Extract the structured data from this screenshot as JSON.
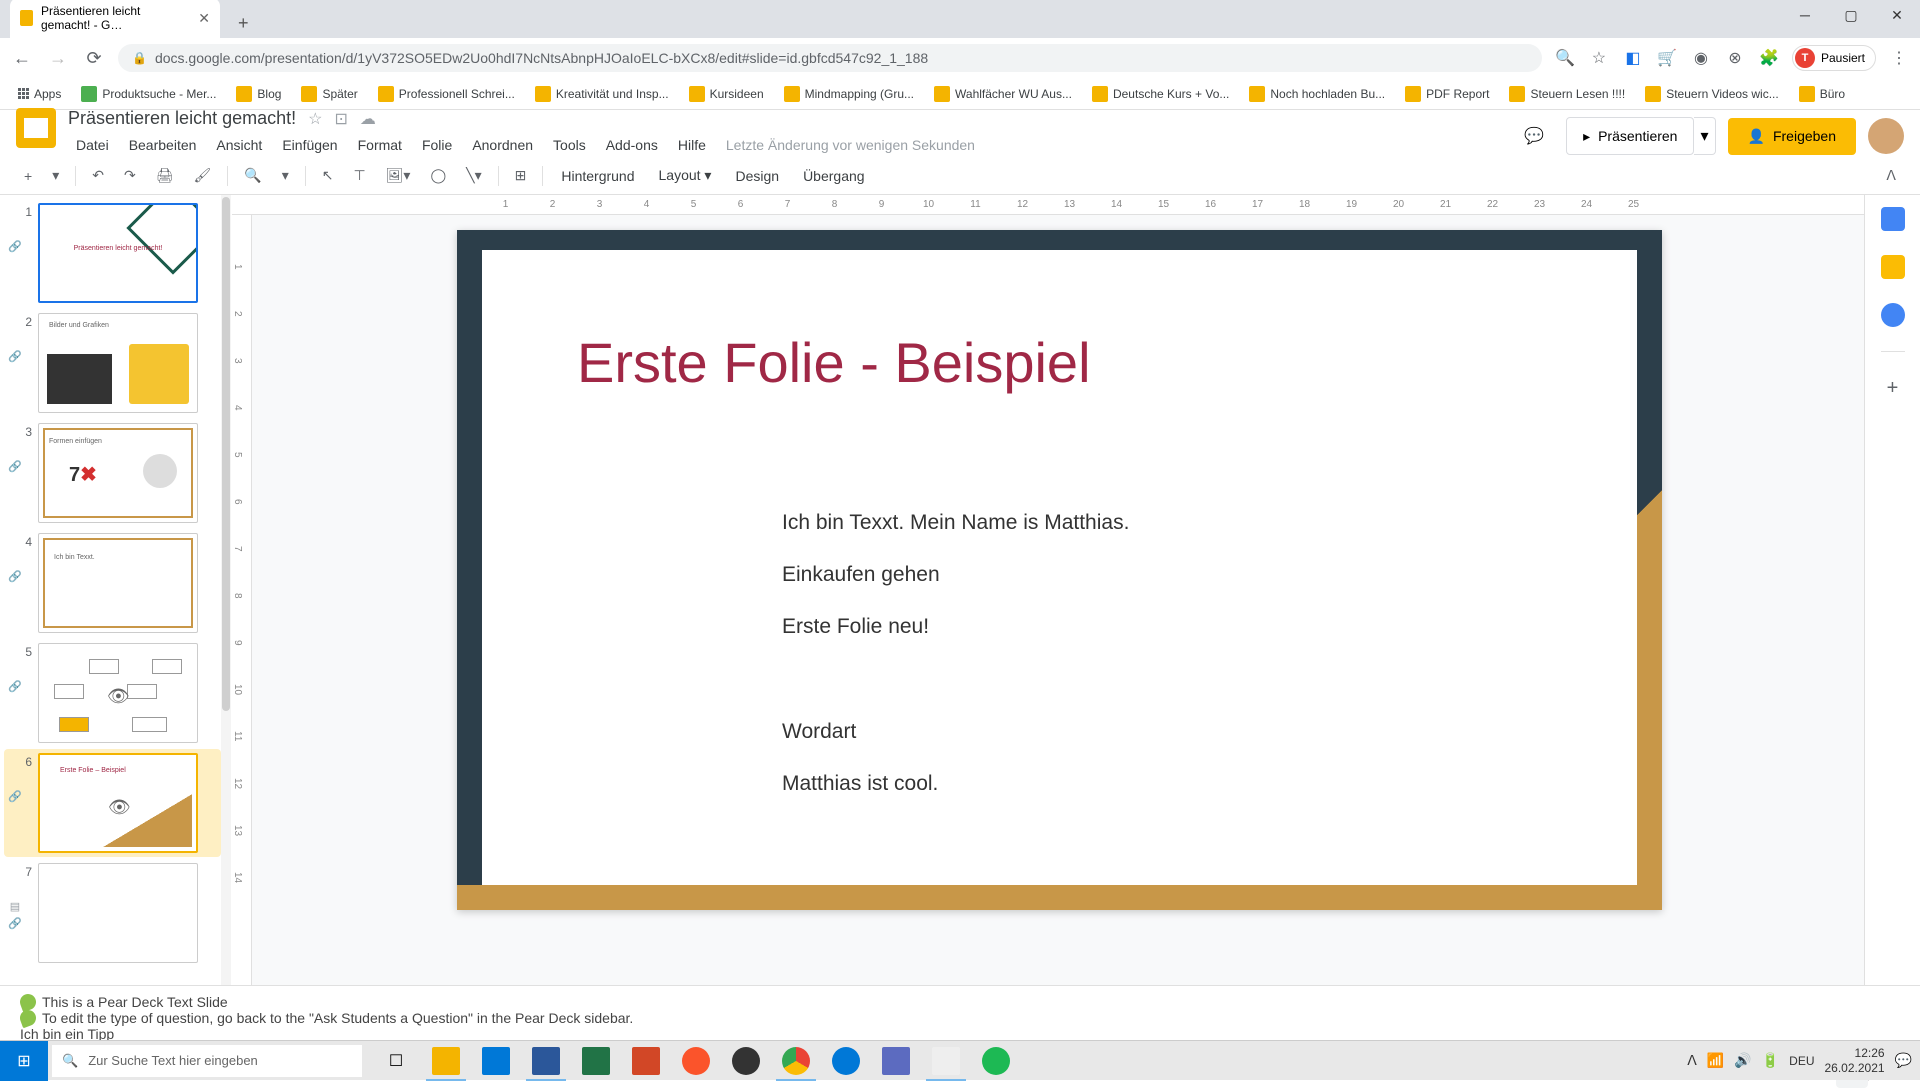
{
  "browser": {
    "tab_title": "Präsentieren leicht gemacht! - G…",
    "url": "docs.google.com/presentation/d/1yV372SO5EDw2Uo0hdI7NcNtsAbnpHJOaIoELC-bXCx8/edit#slide=id.gbfcd547c92_1_188",
    "user_status": "Pausiert",
    "user_initial": "T"
  },
  "bookmarks": [
    {
      "label": "Apps"
    },
    {
      "label": "Produktsuche - Mer..."
    },
    {
      "label": "Blog"
    },
    {
      "label": "Später"
    },
    {
      "label": "Professionell Schrei..."
    },
    {
      "label": "Kreativität und Insp..."
    },
    {
      "label": "Kursideen"
    },
    {
      "label": "Mindmapping (Gru..."
    },
    {
      "label": "Wahlfächer WU Aus..."
    },
    {
      "label": "Deutsche Kurs + Vo..."
    },
    {
      "label": "Noch hochladen Bu..."
    },
    {
      "label": "PDF Report"
    },
    {
      "label": "Steuern Lesen !!!!"
    },
    {
      "label": "Steuern Videos wic..."
    },
    {
      "label": "Büro"
    }
  ],
  "docs": {
    "title": "Präsentieren leicht gemacht!",
    "last_edit": "Letzte Änderung vor wenigen Sekunden",
    "menu": [
      "Datei",
      "Bearbeiten",
      "Ansicht",
      "Einfügen",
      "Format",
      "Folie",
      "Anordnen",
      "Tools",
      "Add-ons",
      "Hilfe"
    ],
    "present": "Präsentieren",
    "share": "Freigeben"
  },
  "toolbar": {
    "background": "Hintergrund",
    "layout": "Layout",
    "design": "Design",
    "transition": "Übergang"
  },
  "slides": {
    "s1": "1",
    "s2": "2",
    "s3": "3",
    "s4": "4",
    "s5": "5",
    "s6": "6",
    "s7": "7",
    "th1_title": "Präsentieren leicht gemacht!",
    "th2_title": "Bilder und Grafiken",
    "th3_num": "7",
    "th3_title": "Formen einfügen",
    "th4_title": "Ich bin Texxt.",
    "th6_title": "Erste Folie – Beispiel"
  },
  "current_slide": {
    "title": "Erste Folie - Beispiel",
    "body1": "Ich bin Texxt. Mein Name is Matthias.",
    "body2": "Einkaufen gehen",
    "body3": "Erste Folie neu!",
    "body4": "Wordart",
    "body5": "Matthias ist cool."
  },
  "ruler_h": [
    "1",
    "2",
    "3",
    "4",
    "5",
    "6",
    "7",
    "8",
    "9",
    "10",
    "11",
    "12",
    "13",
    "14",
    "15",
    "16",
    "17",
    "18",
    "19",
    "20",
    "21",
    "22",
    "23",
    "24",
    "25"
  ],
  "ruler_v": [
    "1",
    "2",
    "3",
    "4",
    "5",
    "6",
    "7",
    "8",
    "9",
    "10",
    "11",
    "12",
    "13",
    "14"
  ],
  "notes": {
    "line1": "This is a Pear Deck Text Slide",
    "line2": "To edit the type of question, go back to the \"Ask Students a Question\" in the Pear Deck sidebar.",
    "line3": "Ich bin ein Tipp"
  },
  "taskbar": {
    "search_placeholder": "Zur Suche Text hier eingeben",
    "lang": "DEU",
    "time": "12:26",
    "date": "26.02.2021"
  }
}
